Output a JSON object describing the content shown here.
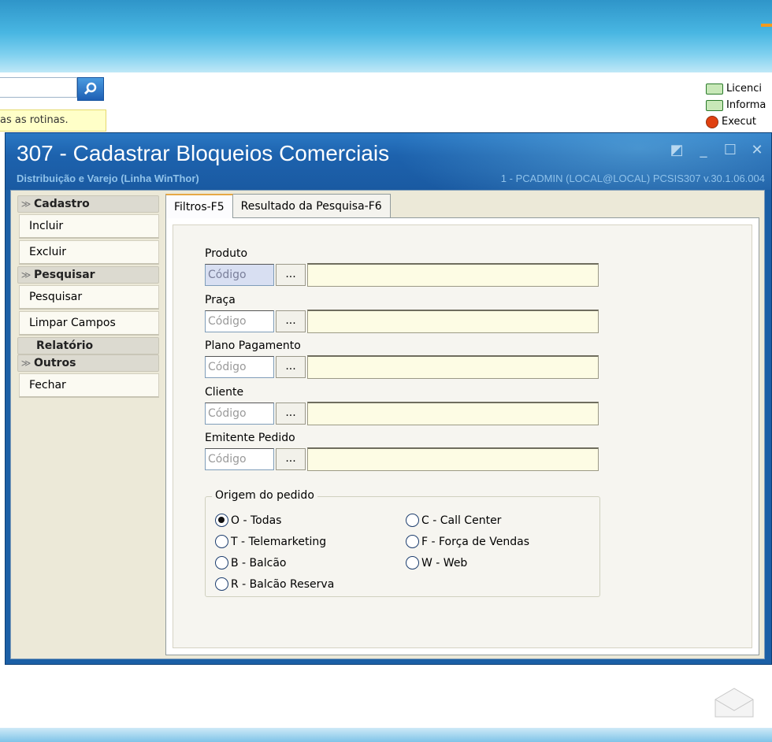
{
  "background": {
    "hint_text": "as as rotinas.",
    "links": [
      "Licenci",
      "Informa",
      "Execut"
    ]
  },
  "window": {
    "title": "307 - Cadastrar Bloqueios Comerciais",
    "subtitle": "Distribuição e Varejo (Linha WinThor)",
    "user_info": "1 - PCADMIN (LOCAL@LOCAL)   PCSIS307  v.30.1.06.004"
  },
  "sidebar": {
    "sections": [
      {
        "title": "Cadastro",
        "items": [
          "Incluir",
          "Excluir"
        ]
      },
      {
        "title": "Pesquisar",
        "items": [
          "Pesquisar",
          "Limpar Campos"
        ]
      },
      {
        "title": "Relatório",
        "items": []
      },
      {
        "title": "Outros",
        "items": [
          "Fechar"
        ]
      }
    ]
  },
  "tabs": [
    "Filtros-F5",
    "Resultado da Pesquisa-F6"
  ],
  "filters": {
    "fields": [
      {
        "label": "Produto",
        "code_placeholder": "Código",
        "button": "..."
      },
      {
        "label": "Praça",
        "code_placeholder": "Código",
        "button": "..."
      },
      {
        "label": "Plano Pagamento",
        "code_placeholder": "Código",
        "button": "..."
      },
      {
        "label": "Cliente",
        "code_placeholder": "Código",
        "button": "..."
      },
      {
        "label": "Emitente Pedido",
        "code_placeholder": "Código",
        "button": "..."
      }
    ],
    "origem": {
      "legend": "Origem do pedido",
      "options": [
        {
          "label": "O - Todas",
          "selected": true
        },
        {
          "label": "C - Call Center",
          "selected": false
        },
        {
          "label": "T - Telemarketing",
          "selected": false
        },
        {
          "label": "F - Força de Vendas",
          "selected": false
        },
        {
          "label": "B - Balcão",
          "selected": false
        },
        {
          "label": "W - Web",
          "selected": false
        },
        {
          "label": "R - Balcão Reserva",
          "selected": false
        }
      ]
    }
  }
}
